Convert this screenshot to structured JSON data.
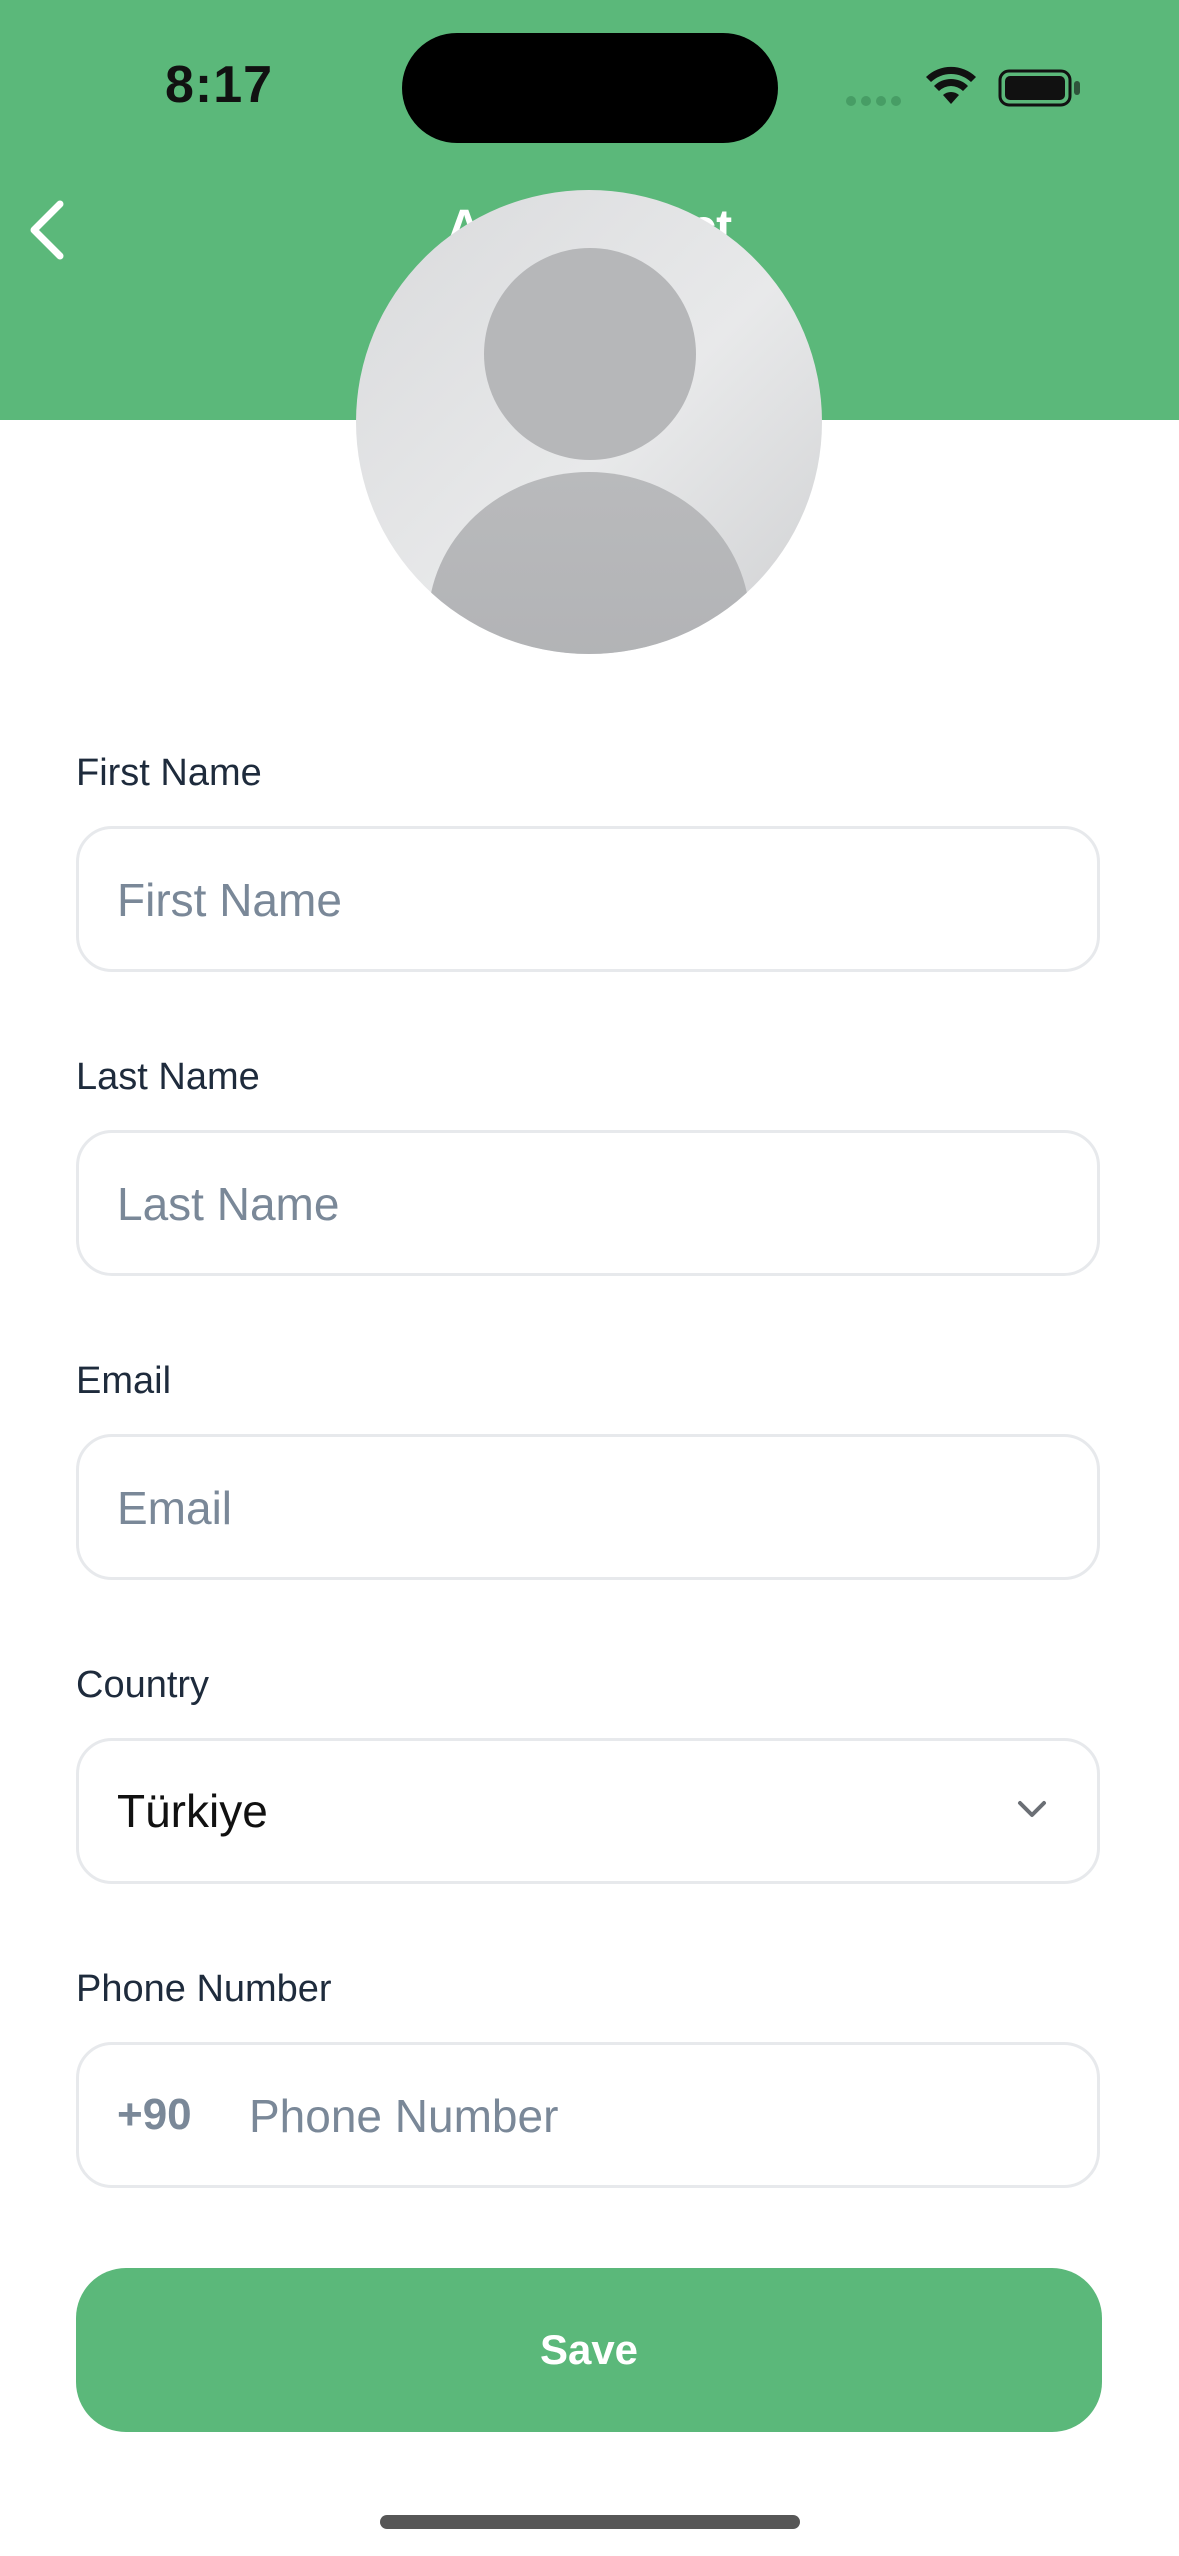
{
  "status_bar": {
    "time": "8:17"
  },
  "header": {
    "title": "Add Contact",
    "background_color": "#5bb87a"
  },
  "avatar": {
    "icon": "person-placeholder-icon"
  },
  "form": {
    "first_name": {
      "label": "First Name",
      "placeholder": "First Name",
      "value": ""
    },
    "last_name": {
      "label": "Last Name",
      "placeholder": "Last Name",
      "value": ""
    },
    "email": {
      "label": "Email",
      "placeholder": "Email",
      "value": ""
    },
    "country": {
      "label": "Country",
      "selected": "Türkiye"
    },
    "phone": {
      "label": "Phone Number",
      "dial_code": "+90",
      "placeholder": "Phone Number",
      "value": ""
    }
  },
  "actions": {
    "save_label": "Save",
    "accent_color": "#5bb87a"
  }
}
